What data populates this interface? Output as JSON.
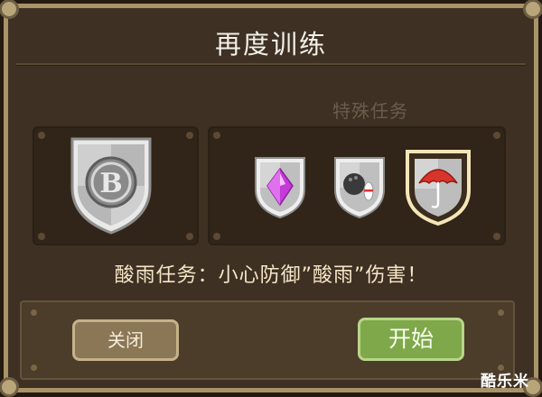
{
  "dialog": {
    "title": "再度训练",
    "special_label": "特殊任务",
    "message": "酸雨任务：小心防御”酸雨”伤害！"
  },
  "badges": {
    "main_letter": "B",
    "items": [
      {
        "name": "purple-gem-icon",
        "selected": false
      },
      {
        "name": "bowling-ball-pins-icon",
        "selected": false
      },
      {
        "name": "red-umbrella-icon",
        "selected": true
      }
    ]
  },
  "buttons": {
    "close_label": "关闭",
    "start_label": "开始"
  },
  "watermark": "酷乐米",
  "colors": {
    "frame": "#a89468",
    "panel": "#312519",
    "start_button": "#7fa84a",
    "close_button": "#8b7755",
    "message_text": "#f6e6c8",
    "special_label": "#6a5d4d"
  }
}
